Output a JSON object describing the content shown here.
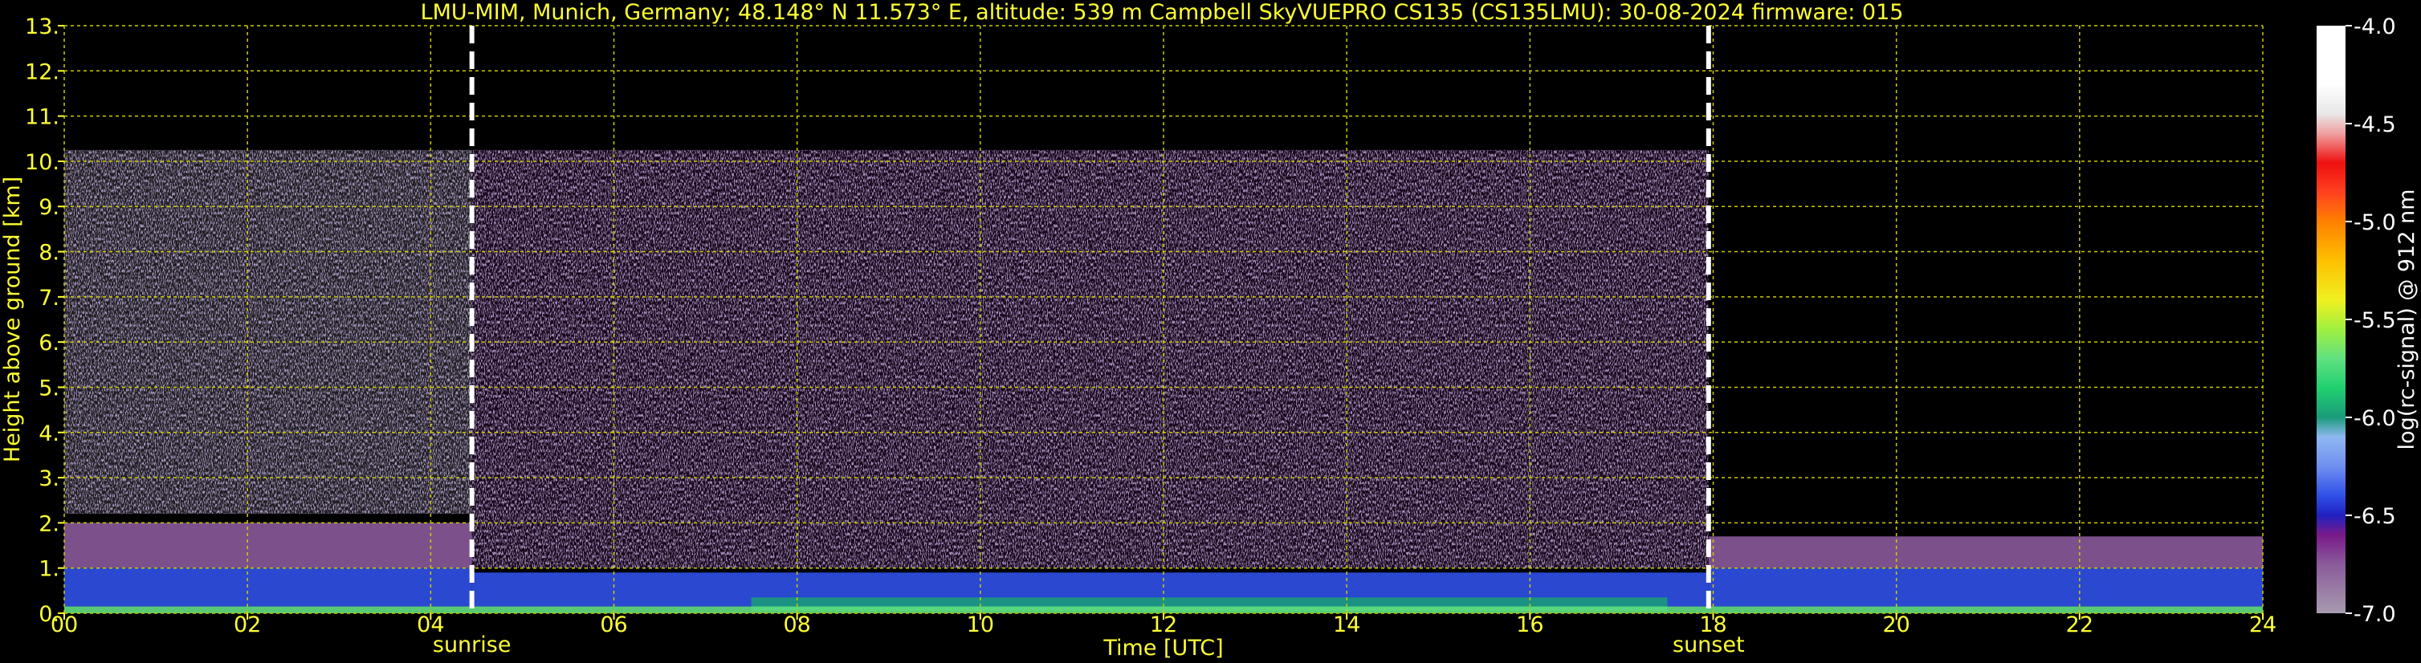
{
  "title": "LMU-MIM, Munich, Germany; 48.148° N 11.573° E, altitude: 539 m    Campbell SkyVUEPRO CS135 (CS135LMU): 30-08-2024    firmware: 015",
  "colors": {
    "text": "#ffff33",
    "grid": "#cccc00",
    "background": "#000000",
    "marker": "#ffffff",
    "colorbar_label": "#ffffff"
  },
  "chart_data": {
    "type": "heatmap",
    "xlabel": "Time [UTC]",
    "ylabel": "Height above ground [km]",
    "xlim": [
      0,
      24
    ],
    "ylim": [
      0,
      13
    ],
    "x_ticks": [
      {
        "value": 0,
        "label": "00"
      },
      {
        "value": 2,
        "label": "02"
      },
      {
        "value": 4,
        "label": "04"
      },
      {
        "value": 6,
        "label": "06"
      },
      {
        "value": 8,
        "label": "08"
      },
      {
        "value": 10,
        "label": "10"
      },
      {
        "value": 12,
        "label": "12"
      },
      {
        "value": 14,
        "label": "14"
      },
      {
        "value": 16,
        "label": "16"
      },
      {
        "value": 18,
        "label": "18"
      },
      {
        "value": 20,
        "label": "20"
      },
      {
        "value": 22,
        "label": "22"
      },
      {
        "value": 24,
        "label": "24"
      }
    ],
    "y_ticks": [
      {
        "value": 0,
        "label": "0."
      },
      {
        "value": 1,
        "label": "1."
      },
      {
        "value": 2,
        "label": "2."
      },
      {
        "value": 3,
        "label": "3."
      },
      {
        "value": 4,
        "label": "4."
      },
      {
        "value": 5,
        "label": "5."
      },
      {
        "value": 6,
        "label": "6."
      },
      {
        "value": 7,
        "label": "7."
      },
      {
        "value": 8,
        "label": "8."
      },
      {
        "value": 9,
        "label": "9."
      },
      {
        "value": 10,
        "label": "10."
      },
      {
        "value": 11,
        "label": "11."
      },
      {
        "value": 12,
        "label": "12."
      },
      {
        "value": 13,
        "label": "13."
      }
    ],
    "grid": true,
    "markers": [
      {
        "label": "sunrise",
        "time": 4.45
      },
      {
        "label": "sunset",
        "time": 17.95
      }
    ],
    "data_top_km": 10.25,
    "colorbar": {
      "label": "log(rc-signal) @ 912 nm",
      "range": [
        -7.0,
        -4.0
      ],
      "ticks": [
        {
          "value": -4.0,
          "label": "-4.0"
        },
        {
          "value": -4.5,
          "label": "-4.5"
        },
        {
          "value": -5.0,
          "label": "-5.0"
        },
        {
          "value": -5.5,
          "label": "-5.5"
        },
        {
          "value": -6.0,
          "label": "-6.0"
        },
        {
          "value": -6.5,
          "label": "-6.5"
        },
        {
          "value": -7.0,
          "label": "-7.0"
        }
      ],
      "stops": [
        {
          "value": -7.0,
          "color": "#a89bb0"
        },
        {
          "value": -6.75,
          "color": "#8a5a9a"
        },
        {
          "value": -6.6,
          "color": "#7a1a8a"
        },
        {
          "value": -6.5,
          "color": "#2020c0"
        },
        {
          "value": -6.4,
          "color": "#3050e8"
        },
        {
          "value": -6.25,
          "color": "#6f8ff0"
        },
        {
          "value": -6.1,
          "color": "#8fb8f0"
        },
        {
          "value": -6.0,
          "color": "#1a9a7a"
        },
        {
          "value": -5.85,
          "color": "#20d070"
        },
        {
          "value": -5.7,
          "color": "#60e080"
        },
        {
          "value": -5.55,
          "color": "#a0f040"
        },
        {
          "value": -5.4,
          "color": "#f0f020"
        },
        {
          "value": -5.2,
          "color": "#ffc000"
        },
        {
          "value": -5.0,
          "color": "#ff8000"
        },
        {
          "value": -4.85,
          "color": "#ff4020"
        },
        {
          "value": -4.7,
          "color": "#ee1010"
        },
        {
          "value": -4.55,
          "color": "#f0a0a0"
        },
        {
          "value": -4.45,
          "color": "#e8e8e8"
        },
        {
          "value": -4.3,
          "color": "#ffffff"
        },
        {
          "value": -4.0,
          "color": "#ffffff"
        }
      ]
    },
    "layers": [
      {
        "name": "noise aloft (day)",
        "t_start": 4.45,
        "t_end": 17.95,
        "h_bottom": 1.0,
        "h_top": 10.25,
        "log_signal": -6.55
      },
      {
        "name": "noise aloft (night)",
        "t_start": 0,
        "t_end": 4.45,
        "h_bottom": 2.2,
        "h_top": 10.25,
        "log_signal": -6.9
      },
      {
        "name": "residual layer (night)",
        "t_start": 0,
        "t_end": 4.45,
        "h_bottom": 1.0,
        "h_top": 2.0,
        "log_signal": -6.75
      },
      {
        "name": "boundary layer (night)",
        "t_start": 0,
        "t_end": 4.45,
        "h_bottom": 0.15,
        "h_top": 1.0,
        "log_signal": -6.35
      },
      {
        "name": "boundary layer (day)",
        "t_start": 4.45,
        "t_end": 17.95,
        "h_bottom": 0.15,
        "h_top": 0.9,
        "log_signal": -6.3
      },
      {
        "name": "surface layer (day)",
        "t_start": 7.5,
        "t_end": 17.5,
        "h_bottom": 0.05,
        "h_top": 0.35,
        "log_signal": -5.9
      },
      {
        "name": "residual layer (evening)",
        "t_start": 17.95,
        "t_end": 24,
        "h_bottom": 1.0,
        "h_top": 1.7,
        "log_signal": -6.65
      },
      {
        "name": "boundary layer (evening)",
        "t_start": 17.95,
        "t_end": 24,
        "h_bottom": 0.15,
        "h_top": 1.0,
        "log_signal": -6.3
      },
      {
        "name": "near-surface",
        "t_start": 0,
        "t_end": 24,
        "h_bottom": 0.0,
        "h_top": 0.15,
        "log_signal": -5.6
      }
    ]
  }
}
